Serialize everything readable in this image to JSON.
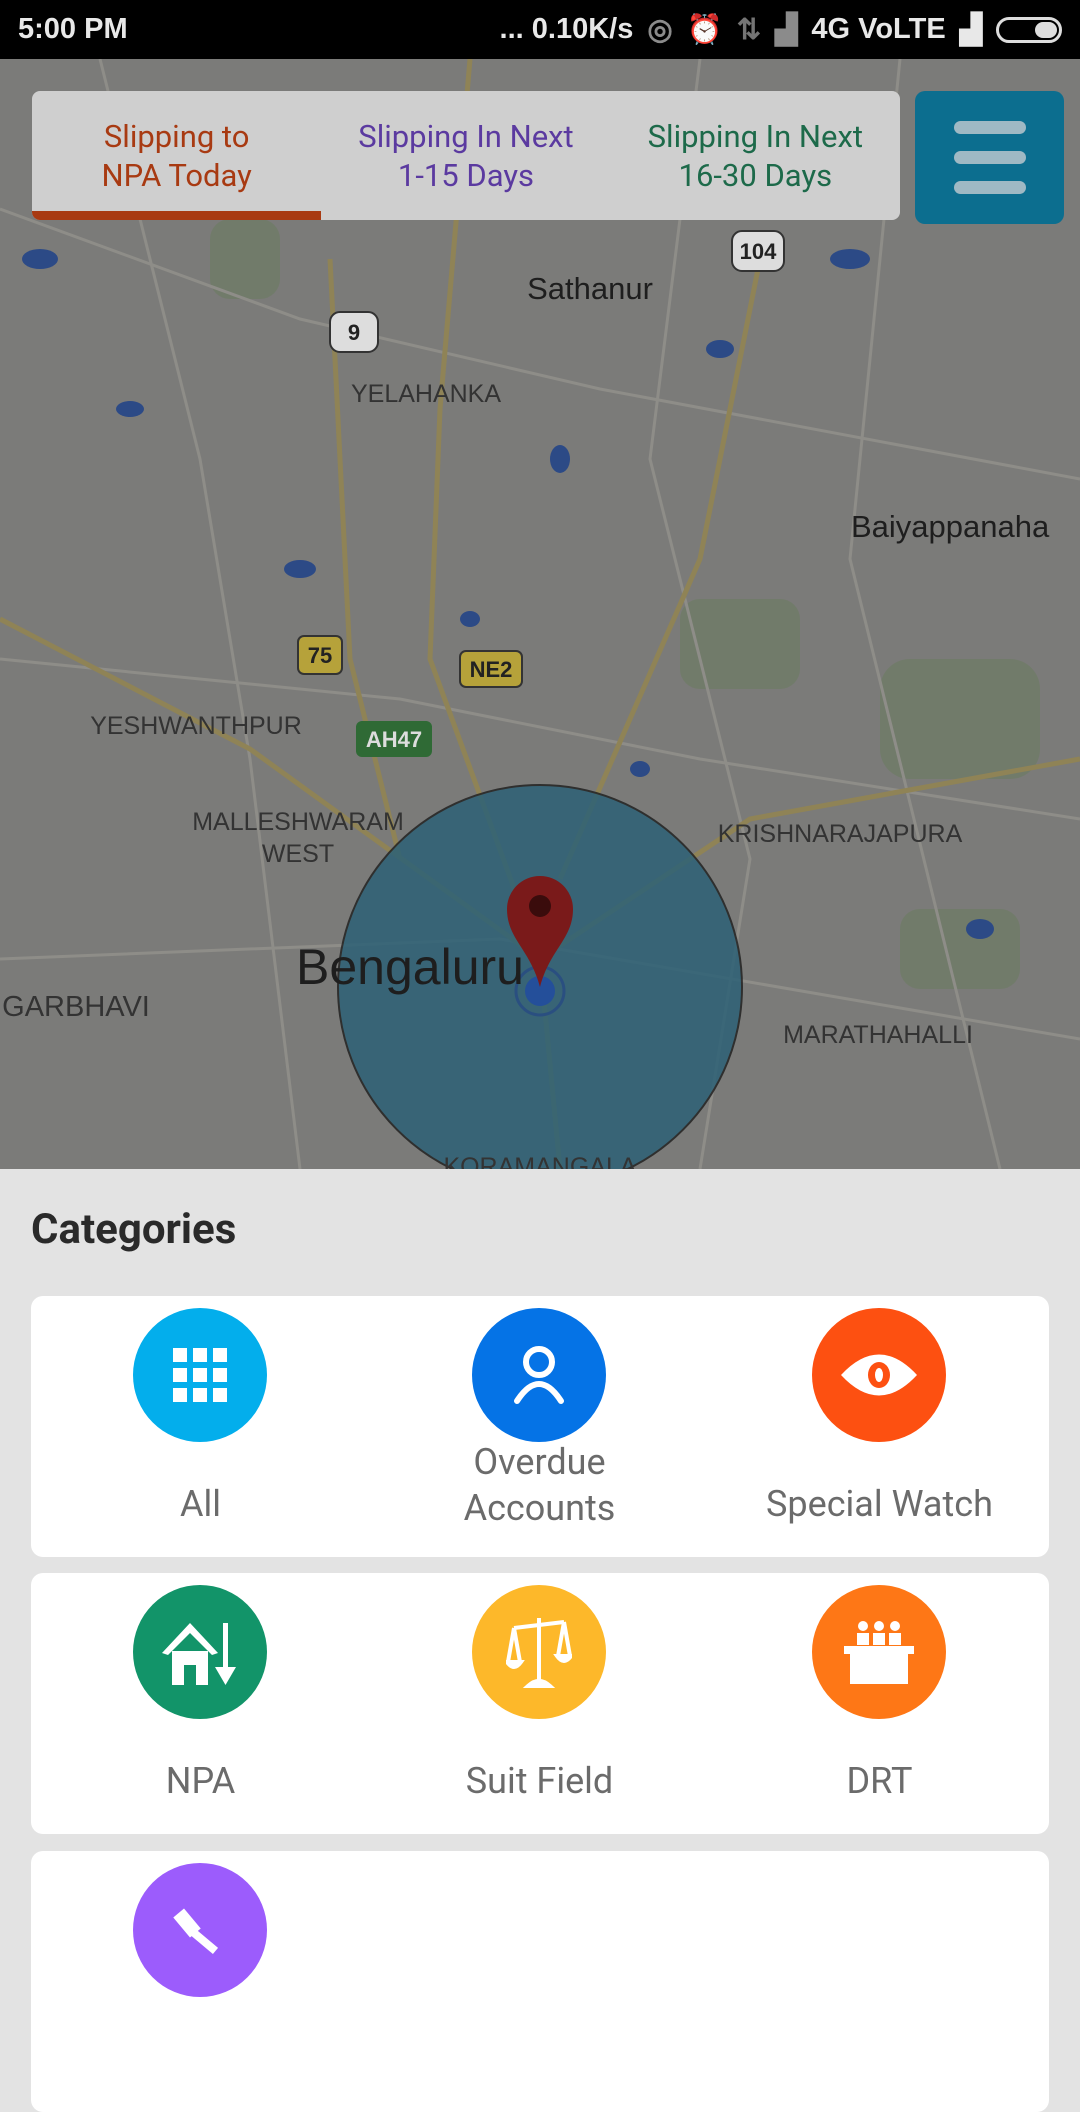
{
  "status_bar": {
    "time": "5:00 PM",
    "network_speed": "... 0.10K/s",
    "network": "4G VoLTE",
    "icons": [
      "hotspot-icon",
      "alarm-icon",
      "data-arrows-icon",
      "signal-icon",
      "signal-icon",
      "battery-icon"
    ]
  },
  "tabs": [
    {
      "label_line1": "Slipping to",
      "label_line2": "NPA Today",
      "color": "#a83a12",
      "active": true
    },
    {
      "label_line1": "Slipping In Next",
      "label_line2": "1-15 Days",
      "color": "#5b3aa0",
      "active": false
    },
    {
      "label_line1": "Slipping In Next",
      "label_line2": "16-30 Days",
      "color": "#1d6a4a",
      "active": false
    }
  ],
  "menu_icon": "hamburger-menu-icon",
  "map": {
    "places": [
      "Sathanur",
      "YELAHANKA",
      "Baiyappanaha",
      "YESHWANTHPUR",
      "MALLESHWARAM",
      "WEST",
      "KRISHNARAJAPURA",
      "Bengaluru",
      "GARBHAVI",
      "MARATHAHALLI",
      "KORAMANGALA"
    ],
    "shields": [
      "104",
      "9",
      "75",
      "NE2",
      "AH47"
    ]
  },
  "categories": {
    "title": "Categories",
    "items": [
      {
        "label": "All",
        "icon": "grid-icon",
        "color": "#03aeec"
      },
      {
        "label_line1": "Overdue",
        "label_line2": "Accounts",
        "icon": "user-icon",
        "color": "#0573e6"
      },
      {
        "label": "Special Watch",
        "icon": "eye-icon",
        "color": "#fd5011"
      },
      {
        "label": "NPA",
        "icon": "house-down-arrow-icon",
        "color": "#129469"
      },
      {
        "label": "Suit Field",
        "icon": "scales-icon",
        "color": "#fdb82a"
      },
      {
        "label": "DRT",
        "icon": "tribunal-icon",
        "color": "#fe7716"
      },
      {
        "label": "",
        "icon": "gavel-icon",
        "color": "#9c5cfc"
      }
    ]
  }
}
